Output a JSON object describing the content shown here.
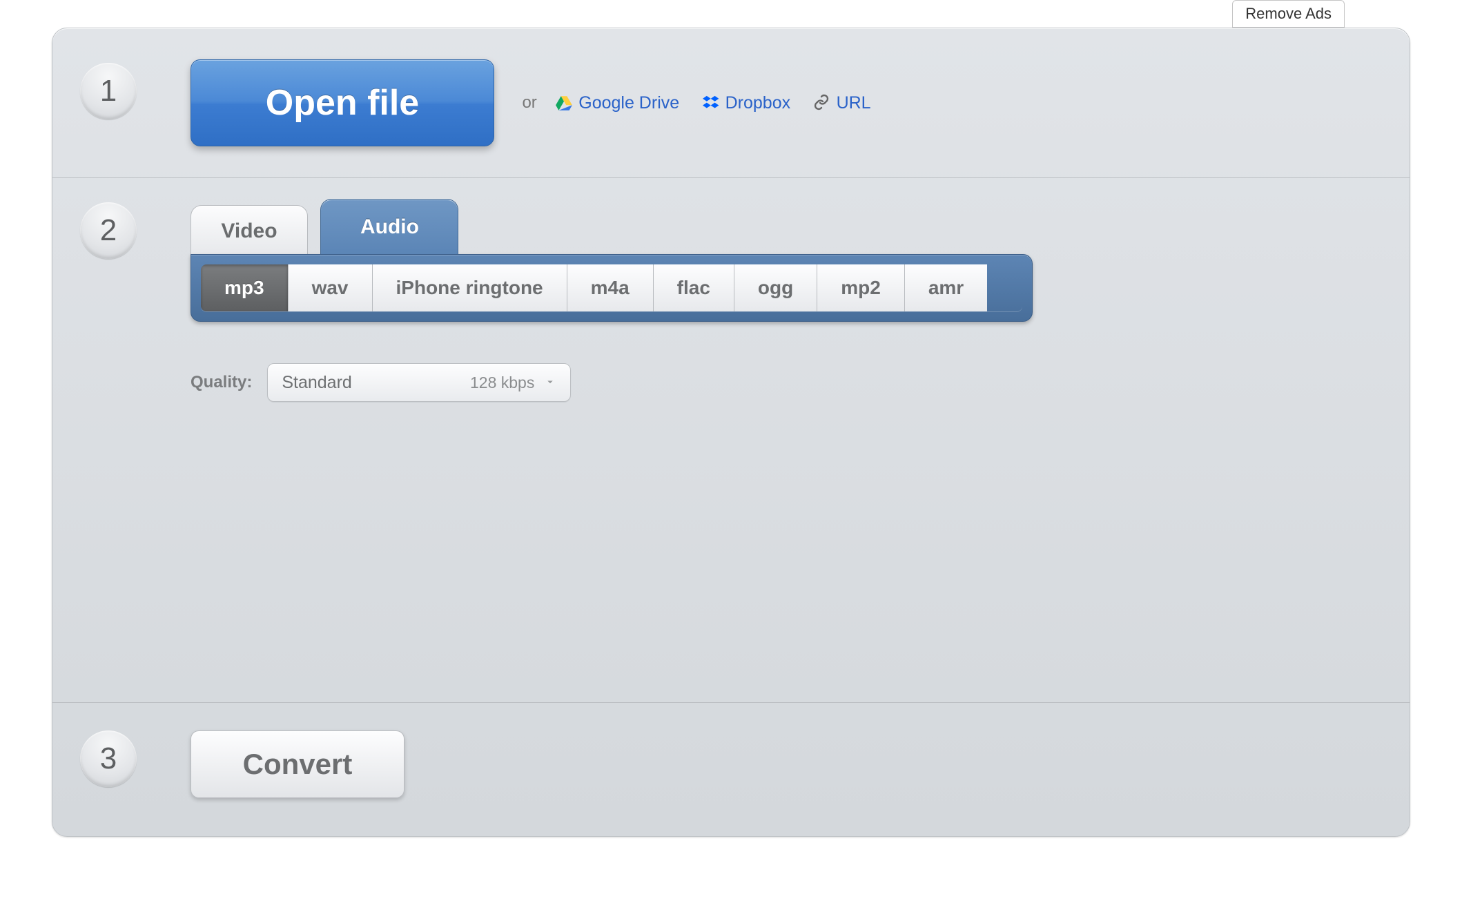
{
  "remove_ads": "Remove Ads",
  "step1": {
    "badge": "1",
    "open_file": "Open file",
    "or": "or",
    "google_drive": "Google Drive",
    "dropbox": "Dropbox",
    "url": "URL"
  },
  "step2": {
    "badge": "2",
    "tabs": {
      "video": "Video",
      "audio": "Audio"
    },
    "formats": [
      "mp3",
      "wav",
      "iPhone ringtone",
      "m4a",
      "flac",
      "ogg",
      "mp2",
      "amr"
    ],
    "active_format_index": 0,
    "quality_label": "Quality:",
    "quality": {
      "name": "Standard",
      "rate": "128 kbps"
    }
  },
  "step3": {
    "badge": "3",
    "convert": "Convert"
  }
}
